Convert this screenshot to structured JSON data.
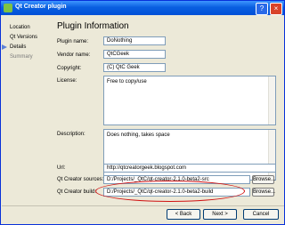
{
  "window": {
    "title": "Qt Creator plugin",
    "help_glyph": "?",
    "close_glyph": "×"
  },
  "sidebar": {
    "items": [
      {
        "label": "Location",
        "state": "done"
      },
      {
        "label": "Qt Versions",
        "state": "done"
      },
      {
        "label": "Details",
        "state": "current"
      },
      {
        "label": "Summary",
        "state": "pending"
      }
    ]
  },
  "page": {
    "title": "Plugin Information",
    "plugin_name_label": "Plugin name:",
    "plugin_name_value": "DoNothing",
    "vendor_name_label": "Vendor name:",
    "vendor_name_value": "QtCGeek",
    "copyright_label": "Copyright:",
    "copyright_value": "(C) QtC Geek",
    "license_label": "License:",
    "license_value": "Free to copy/use",
    "description_label": "Description:",
    "description_value": "Does nothing, takes space",
    "url_label": "Url:",
    "url_value": "http://qtcreatorgeek.blogspot.com",
    "sources_label": "Qt Creator sources:",
    "sources_value": "D:/Projects/_QtC/qt-creator-2.1.0-beta2-src",
    "build_label": "Qt Creator build:",
    "build_value": "D:/Projects/_QtC/qt-creator-2.1.0-beta2-build",
    "browse_label": "Browse..."
  },
  "footer": {
    "back_label": "< Back",
    "next_label": "Next >",
    "cancel_label": "Cancel"
  },
  "colors": {
    "titlebar": "#0a5fe0",
    "highlight_ellipse": "#d01010",
    "window_bg": "#ece9d8"
  }
}
